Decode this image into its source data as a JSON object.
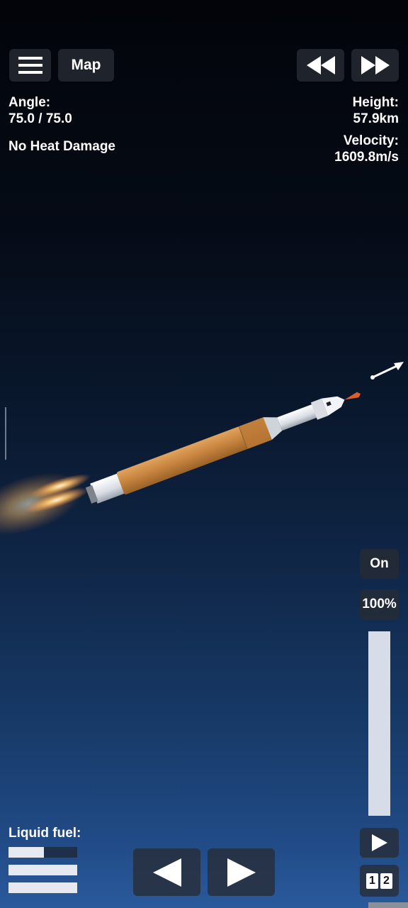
{
  "toolbar": {
    "map_label": "Map",
    "menu_icon": "hamburger-menu-icon",
    "rewind_icon": "rewind-icon",
    "fast_forward_icon": "fast-forward-icon"
  },
  "telemetry": {
    "angle_label": "Angle:",
    "angle_value": "75.0 / 75.0",
    "heat_status": "No Heat Damage",
    "height_label": "Height:",
    "height_value": "57.9km",
    "velocity_label": "Velocity:",
    "velocity_value": "1609.8m/s"
  },
  "engine": {
    "state_label": "On",
    "throttle_label": "100%",
    "throttle_level": 1.0
  },
  "staging": {
    "stage_1": "1",
    "stage_2": "2"
  },
  "fuel": {
    "label": "Liquid fuel:",
    "levels": [
      0.52,
      1.0,
      1.0
    ]
  },
  "controls": {
    "rotate_left_icon": "left-arrow-icon",
    "rotate_right_icon": "right-arrow-icon",
    "play_icon": "play-icon"
  },
  "colors": {
    "rocket_orange": "#c98a45",
    "flame": "#ffb347",
    "button_bg": "#2a2e36"
  }
}
